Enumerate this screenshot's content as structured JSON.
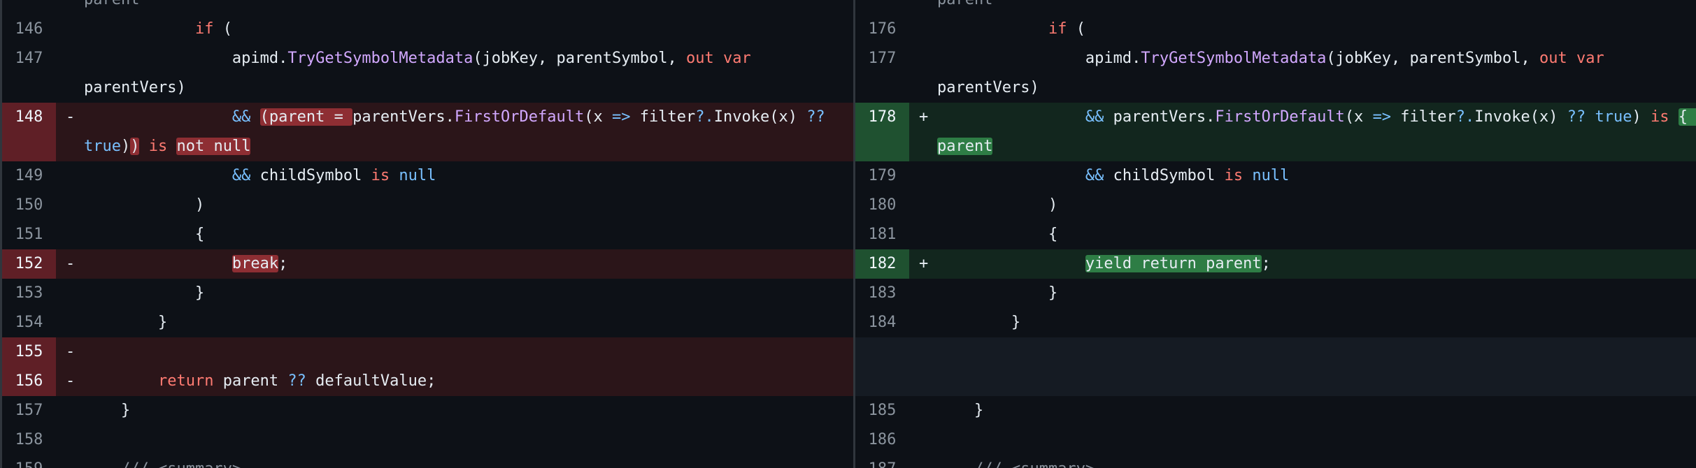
{
  "left": {
    "rows": [
      {
        "type": "cont",
        "num": "",
        "marker": "",
        "indent": "",
        "segs": [
          {
            "t": "parent",
            "c": "cm"
          }
        ]
      },
      {
        "type": "ctx",
        "num": "146",
        "marker": "",
        "indent": "            ",
        "segs": [
          {
            "t": "if",
            "c": "kw"
          },
          {
            "t": " ("
          }
        ]
      },
      {
        "type": "ctx",
        "num": "147",
        "marker": "",
        "indent": "                ",
        "segs": [
          {
            "t": "apimd."
          },
          {
            "t": "TryGetSymbolMetadata",
            "c": "fn"
          },
          {
            "t": "(jobKey, parentSymbol, "
          },
          {
            "t": "out",
            "c": "kw"
          },
          {
            "t": " "
          },
          {
            "t": "var",
            "c": "kw"
          }
        ]
      },
      {
        "type": "cont",
        "num": "",
        "marker": "",
        "indent": "",
        "segs": [
          {
            "t": "parentVers)"
          }
        ]
      },
      {
        "type": "del",
        "num": "148",
        "marker": "-",
        "indent": "                ",
        "segs": [
          {
            "t": "&&",
            "c": "op"
          },
          {
            "t": " "
          },
          {
            "t": "(parent = ",
            "h": "hl-del"
          },
          {
            "t": "parentVers."
          },
          {
            "t": "FirstOrDefault",
            "c": "fn"
          },
          {
            "t": "(x "
          },
          {
            "t": "=>",
            "c": "op"
          },
          {
            "t": " filter"
          },
          {
            "t": "?.",
            "c": "op"
          },
          {
            "t": "Invoke(x) "
          },
          {
            "t": "??",
            "c": "op"
          }
        ]
      },
      {
        "type": "del",
        "cont": true,
        "num": "",
        "marker": "",
        "indent": "",
        "segs": [
          {
            "t": "true",
            "c": "op"
          },
          {
            "t": ")"
          },
          {
            "t": ")",
            "h": "hl-del"
          },
          {
            "t": " "
          },
          {
            "t": "is",
            "c": "kw"
          },
          {
            "t": " "
          },
          {
            "t": "not null",
            "h": "hl-del"
          }
        ]
      },
      {
        "type": "ctx",
        "num": "149",
        "marker": "",
        "indent": "                ",
        "segs": [
          {
            "t": "&&",
            "c": "op"
          },
          {
            "t": " childSymbol "
          },
          {
            "t": "is",
            "c": "kw"
          },
          {
            "t": " "
          },
          {
            "t": "null",
            "c": "op"
          }
        ]
      },
      {
        "type": "ctx",
        "num": "150",
        "marker": "",
        "indent": "            ",
        "segs": [
          {
            "t": ")"
          }
        ]
      },
      {
        "type": "ctx",
        "num": "151",
        "marker": "",
        "indent": "            ",
        "segs": [
          {
            "t": "{"
          }
        ]
      },
      {
        "type": "del",
        "num": "152",
        "marker": "-",
        "indent": "                ",
        "segs": [
          {
            "t": "break",
            "h": "hl-del"
          },
          {
            "t": ";"
          }
        ]
      },
      {
        "type": "ctx",
        "num": "153",
        "marker": "",
        "indent": "            ",
        "segs": [
          {
            "t": "}"
          }
        ]
      },
      {
        "type": "ctx",
        "num": "154",
        "marker": "",
        "indent": "        ",
        "segs": [
          {
            "t": "}"
          }
        ]
      },
      {
        "type": "del",
        "num": "155",
        "marker": "-",
        "indent": "",
        "segs": []
      },
      {
        "type": "del",
        "num": "156",
        "marker": "-",
        "indent": "        ",
        "segs": [
          {
            "t": "return",
            "c": "kw"
          },
          {
            "t": " parent "
          },
          {
            "t": "??",
            "c": "op"
          },
          {
            "t": " defaultValue;"
          }
        ]
      },
      {
        "type": "ctx",
        "num": "157",
        "marker": "",
        "indent": "    ",
        "segs": [
          {
            "t": "}"
          }
        ]
      },
      {
        "type": "ctx",
        "num": "158",
        "marker": "",
        "indent": "",
        "segs": []
      },
      {
        "type": "ctx",
        "num": "159",
        "marker": "",
        "indent": "    ",
        "segs": [
          {
            "t": "/// <summary>",
            "c": "cm"
          }
        ]
      }
    ]
  },
  "right": {
    "rows": [
      {
        "type": "cont",
        "num": "",
        "marker": "",
        "indent": "",
        "segs": [
          {
            "t": "parent",
            "c": "cm"
          }
        ]
      },
      {
        "type": "ctx",
        "num": "176",
        "marker": "",
        "indent": "            ",
        "segs": [
          {
            "t": "if",
            "c": "kw"
          },
          {
            "t": " ("
          }
        ]
      },
      {
        "type": "ctx",
        "num": "177",
        "marker": "",
        "indent": "                ",
        "segs": [
          {
            "t": "apimd."
          },
          {
            "t": "TryGetSymbolMetadata",
            "c": "fn"
          },
          {
            "t": "(jobKey, parentSymbol, "
          },
          {
            "t": "out",
            "c": "kw"
          },
          {
            "t": " "
          },
          {
            "t": "var",
            "c": "kw"
          }
        ]
      },
      {
        "type": "cont",
        "num": "",
        "marker": "",
        "indent": "",
        "segs": [
          {
            "t": "parentVers)"
          }
        ]
      },
      {
        "type": "add",
        "num": "178",
        "marker": "+",
        "indent": "                ",
        "segs": [
          {
            "t": "&&",
            "c": "op"
          },
          {
            "t": " parentVers."
          },
          {
            "t": "FirstOrDefault",
            "c": "fn"
          },
          {
            "t": "(x "
          },
          {
            "t": "=>",
            "c": "op"
          },
          {
            "t": " filter"
          },
          {
            "t": "?.",
            "c": "op"
          },
          {
            "t": "Invoke(x) "
          },
          {
            "t": "??",
            "c": "op"
          },
          {
            "t": " "
          },
          {
            "t": "true",
            "c": "op"
          },
          {
            "t": ") "
          },
          {
            "t": "is",
            "c": "kw"
          },
          {
            "t": " "
          },
          {
            "t": "{ }",
            "h": "hl-add"
          }
        ]
      },
      {
        "type": "add",
        "cont": true,
        "num": "",
        "marker": "",
        "indent": "",
        "segs": [
          {
            "t": "parent",
            "h": "hl-add"
          }
        ]
      },
      {
        "type": "ctx",
        "num": "179",
        "marker": "",
        "indent": "                ",
        "segs": [
          {
            "t": "&&",
            "c": "op"
          },
          {
            "t": " childSymbol "
          },
          {
            "t": "is",
            "c": "kw"
          },
          {
            "t": " "
          },
          {
            "t": "null",
            "c": "op"
          }
        ]
      },
      {
        "type": "ctx",
        "num": "180",
        "marker": "",
        "indent": "            ",
        "segs": [
          {
            "t": ")"
          }
        ]
      },
      {
        "type": "ctx",
        "num": "181",
        "marker": "",
        "indent": "            ",
        "segs": [
          {
            "t": "{"
          }
        ]
      },
      {
        "type": "add",
        "num": "182",
        "marker": "+",
        "indent": "                ",
        "segs": [
          {
            "t": "yield return parent",
            "h": "hl-add"
          },
          {
            "t": ";"
          }
        ]
      },
      {
        "type": "ctx",
        "num": "183",
        "marker": "",
        "indent": "            ",
        "segs": [
          {
            "t": "}"
          }
        ]
      },
      {
        "type": "ctx",
        "num": "184",
        "marker": "",
        "indent": "        ",
        "segs": [
          {
            "t": "}"
          }
        ]
      },
      {
        "type": "empty",
        "num": "",
        "marker": "",
        "indent": "",
        "segs": []
      },
      {
        "type": "empty",
        "num": "",
        "marker": "",
        "indent": "",
        "segs": []
      },
      {
        "type": "ctx",
        "num": "185",
        "marker": "",
        "indent": "    ",
        "segs": [
          {
            "t": "}"
          }
        ]
      },
      {
        "type": "ctx",
        "num": "186",
        "marker": "",
        "indent": "",
        "segs": []
      },
      {
        "type": "ctx",
        "num": "187",
        "marker": "",
        "indent": "    ",
        "segs": [
          {
            "t": "/// <summary>",
            "c": "cm"
          }
        ]
      }
    ]
  }
}
